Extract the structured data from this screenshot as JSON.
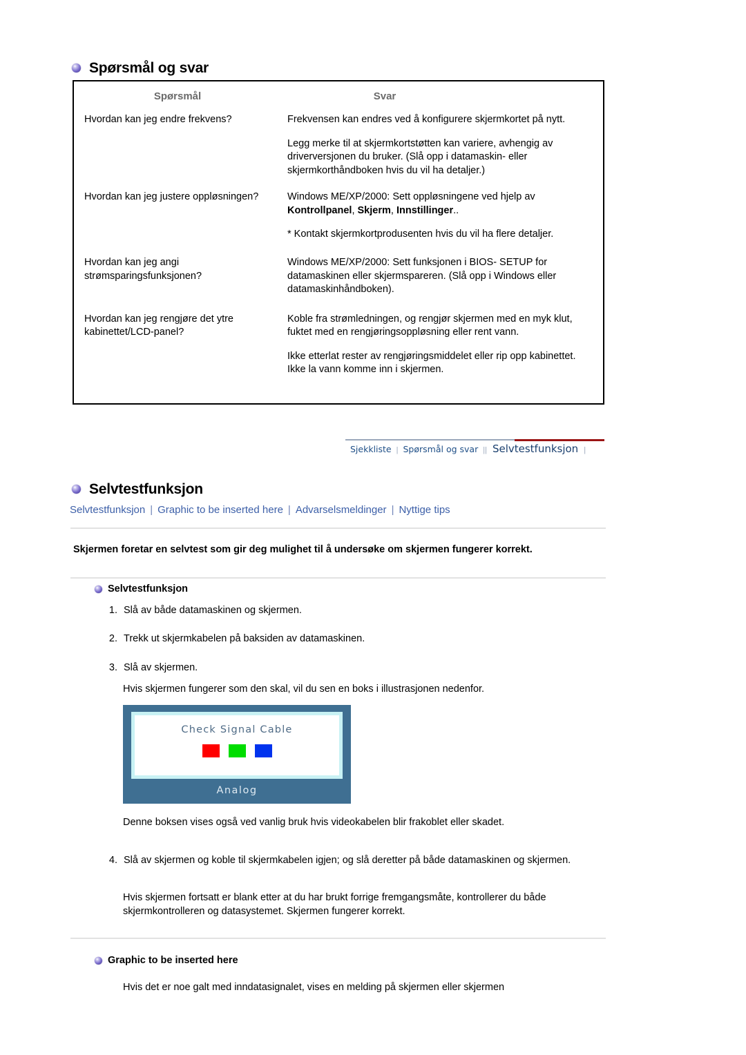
{
  "faq": {
    "heading": "Spørsmål og svar",
    "columns": [
      "Spørsmål",
      "Svar"
    ],
    "rows": [
      {
        "question": "Hvordan kan jeg endre frekvens?",
        "answers": [
          "Frekvensen kan endres ved å konfigurere skjermkortet på nytt.",
          "Legg merke til at skjermkortstøtten kan variere, avhengig av driverversjonen du bruker. (Slå opp i datamaskin- eller skjermkorthåndboken hvis du vil ha detaljer.)"
        ]
      },
      {
        "question": "Hvordan kan jeg justere oppløsningen?",
        "answer_intro": "Windows ME/XP/2000: Sett oppløsningene ved hjelp av ",
        "answer_bold": [
          "Kontrollpanel",
          "Skjerm",
          "Innstillinger"
        ],
        "answer_tail": "..",
        "answers": [
          "* Kontakt skjermkortprodusenten hvis du vil ha flere detaljer."
        ]
      },
      {
        "question": "Hvordan kan jeg angi strømsparingsfunksjonen?",
        "answers": [
          "Windows ME/XP/2000: Sett funksjonen i BIOS- SETUP for datamaskinen eller skjermspareren. (Slå opp i Windows eller datamaskinhåndboken)."
        ]
      },
      {
        "question": "Hvordan kan jeg rengjøre det ytre kabinettet/LCD-panel?",
        "answers": [
          "Koble fra strømledningen, og rengjør skjermen med en myk klut, fuktet med en rengjøringsoppløsning eller rent vann.",
          "Ikke etterlat rester av rengjøringsmiddelet eller rip opp kabinettet. Ikke la vann komme inn i skjermen."
        ]
      }
    ]
  },
  "breadcrumb": {
    "items": [
      {
        "label": "Sjekkliste",
        "current": false
      },
      {
        "label": "Spørsmål og svar",
        "current": false
      },
      {
        "label": "Selvtestfunksjon",
        "current": true
      }
    ],
    "separator": "|",
    "accent_color": "#9b1414",
    "link_color": "#1f4f87"
  },
  "selftest": {
    "heading": "Selvtestfunksjon",
    "links": [
      "Selvtestfunksjon",
      "Graphic to be inserted here",
      "Advarselsmeldinger",
      "Nyttige tips"
    ],
    "link_separator": "|",
    "lead": "Skjermen foretar en selvtest som gir deg mulighet til å undersøke om skjermen fungerer korrekt.",
    "sub_heading": "Selvtestfunksjon",
    "steps": [
      "Slå av både datamaskinen og skjermen.",
      "Trekk ut skjermkabelen på baksiden av datamaskinen.",
      "Slå av skjermen."
    ],
    "note_after_step3": "Hvis skjermen fungerer som den skal, vil du sen en boks i illustrasjonen nedenfor.",
    "monitor": {
      "message": "Check Signal Cable",
      "label": "Analog",
      "frame_color": "#3f6f92",
      "inner_border_color": "#c8f2f4",
      "swatches": [
        "#ff0000",
        "#00dd00",
        "#0033ee"
      ]
    },
    "note_after_figure": "Denne boksen vises også ved vanlig bruk hvis videokabelen blir frakoblet eller skadet.",
    "step4": "Slå av skjermen og koble til skjermkabelen igjen; og slå deretter på både datamaskinen og skjermen.",
    "note_after_step4": "Hvis skjermen fortsatt er blank etter at du har brukt forrige fremgangsmåte, kontrollerer du både skjermkontrolleren og datasystemet. Skjermen fungerer korrekt."
  },
  "graphic_section": {
    "sub_heading": "Graphic to be inserted here",
    "body": "Hvis det er noe galt med inndatasignalet, vises en melding på skjermen eller skjermen"
  }
}
